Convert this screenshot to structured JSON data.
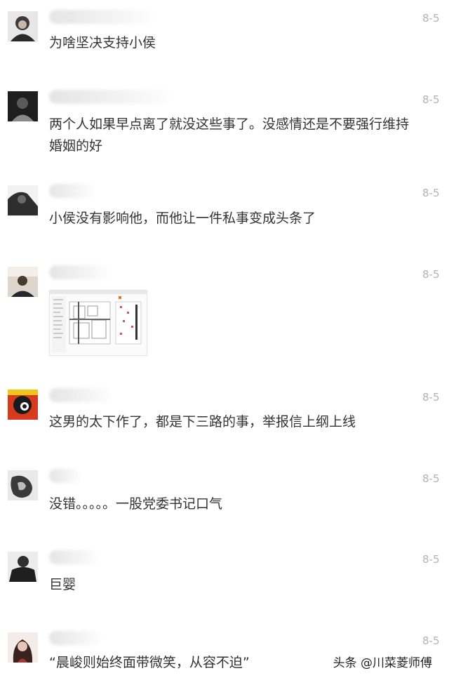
{
  "comments": [
    {
      "time": "8-5",
      "text": "为啥坚决支持小侯"
    },
    {
      "time": "8-5",
      "text": "两个人如果早点离了就没这些事了。没感情还是不要强行维持\n婚姻的好"
    },
    {
      "time": "8-5",
      "text": "小侯没有影响他，而他让一件私事变成头条了"
    },
    {
      "time": "8-5",
      "text": ""
    },
    {
      "time": "8-5",
      "text": "这男的太下作了，都是下三路的事，举报信上纲上线"
    },
    {
      "time": "8-5",
      "text": "没错。。。。。一股党委书记口气"
    },
    {
      "time": "8-5",
      "text": "巨婴"
    },
    {
      "time": "8-5",
      "text": "“晨峻则始终面带微笑，从容不迫”"
    }
  ],
  "watermark": "头条 @川菜菱师傅",
  "colors": {
    "text": "#333333",
    "time": "#b3b3b3",
    "background": "#ffffff"
  }
}
